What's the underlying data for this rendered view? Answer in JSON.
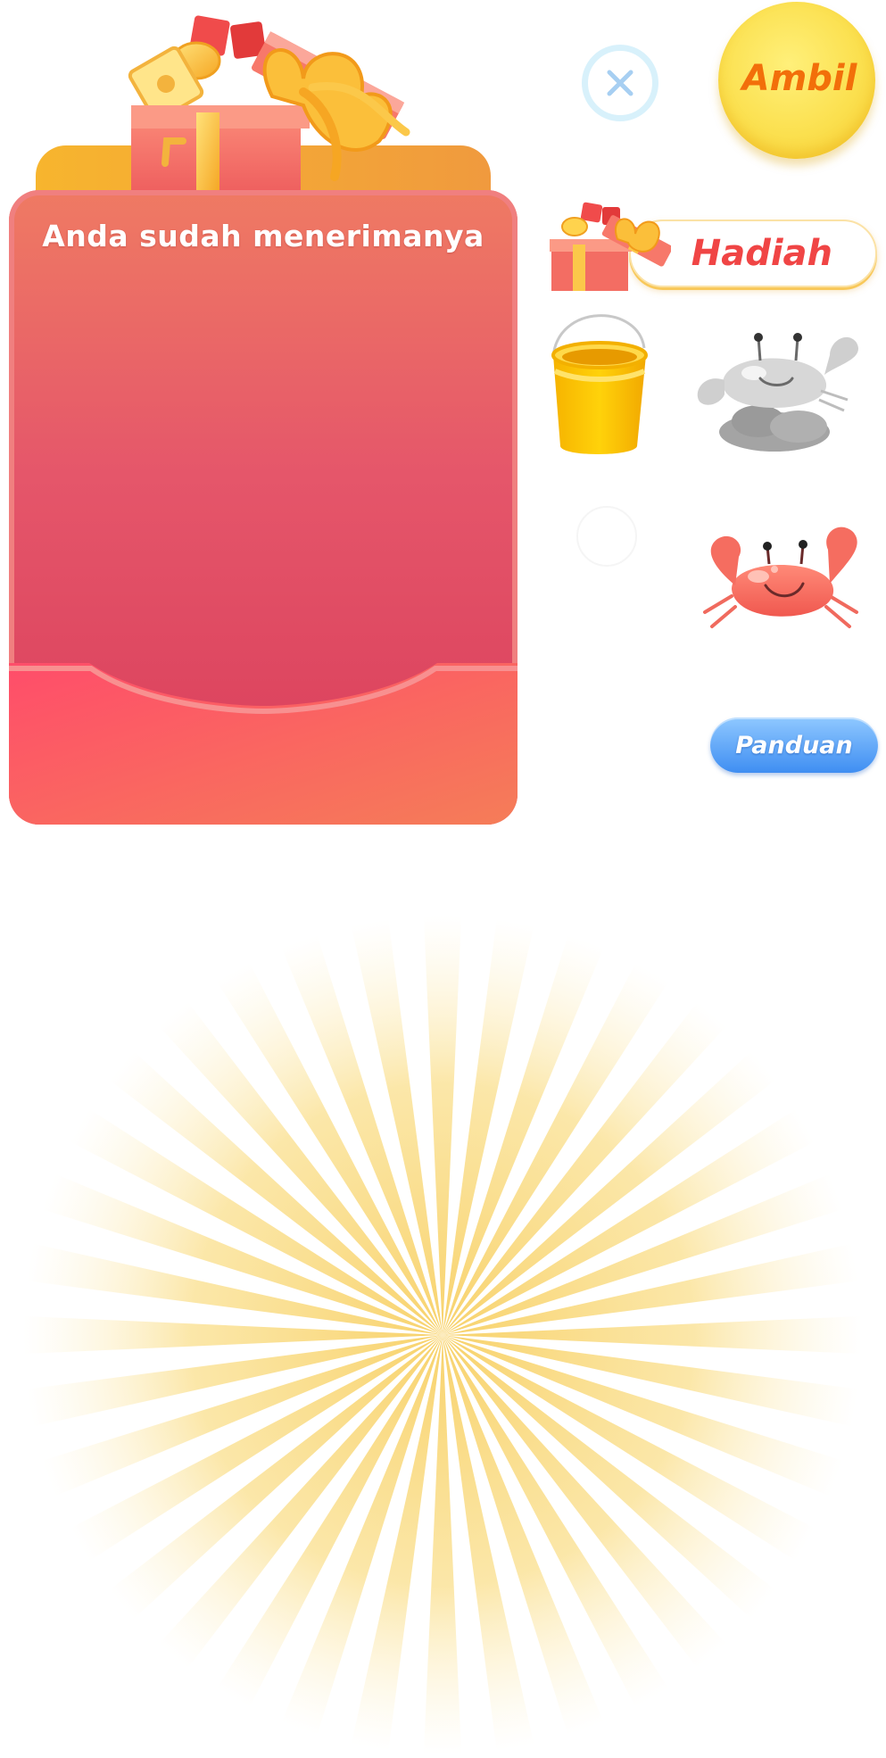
{
  "envelope": {
    "title": "Anda sudah menerimanya"
  },
  "actions": {
    "close_icon": "close-icon",
    "ambil_label": "Ambil",
    "hadiah_label": "Hadiah",
    "panduan_label": "Panduan"
  },
  "colors": {
    "envelope_top": "#ef7a63",
    "envelope_bottom": "#d93d5a",
    "ambil_bg": "#fbe04f",
    "ambil_text": "#f26f0a",
    "hadiah_text": "#f04545",
    "panduan_bg": "#3f8ef2",
    "sunburst": "#f8d26b"
  },
  "icons": {
    "gift_box_large": "gift-box-icon",
    "gift_box_small": "gift-box-small-icon",
    "bucket": "bucket-icon",
    "crab_gray": "crab-gray-icon",
    "crab_red": "crab-red-icon",
    "sunburst": "sunburst-rays"
  }
}
